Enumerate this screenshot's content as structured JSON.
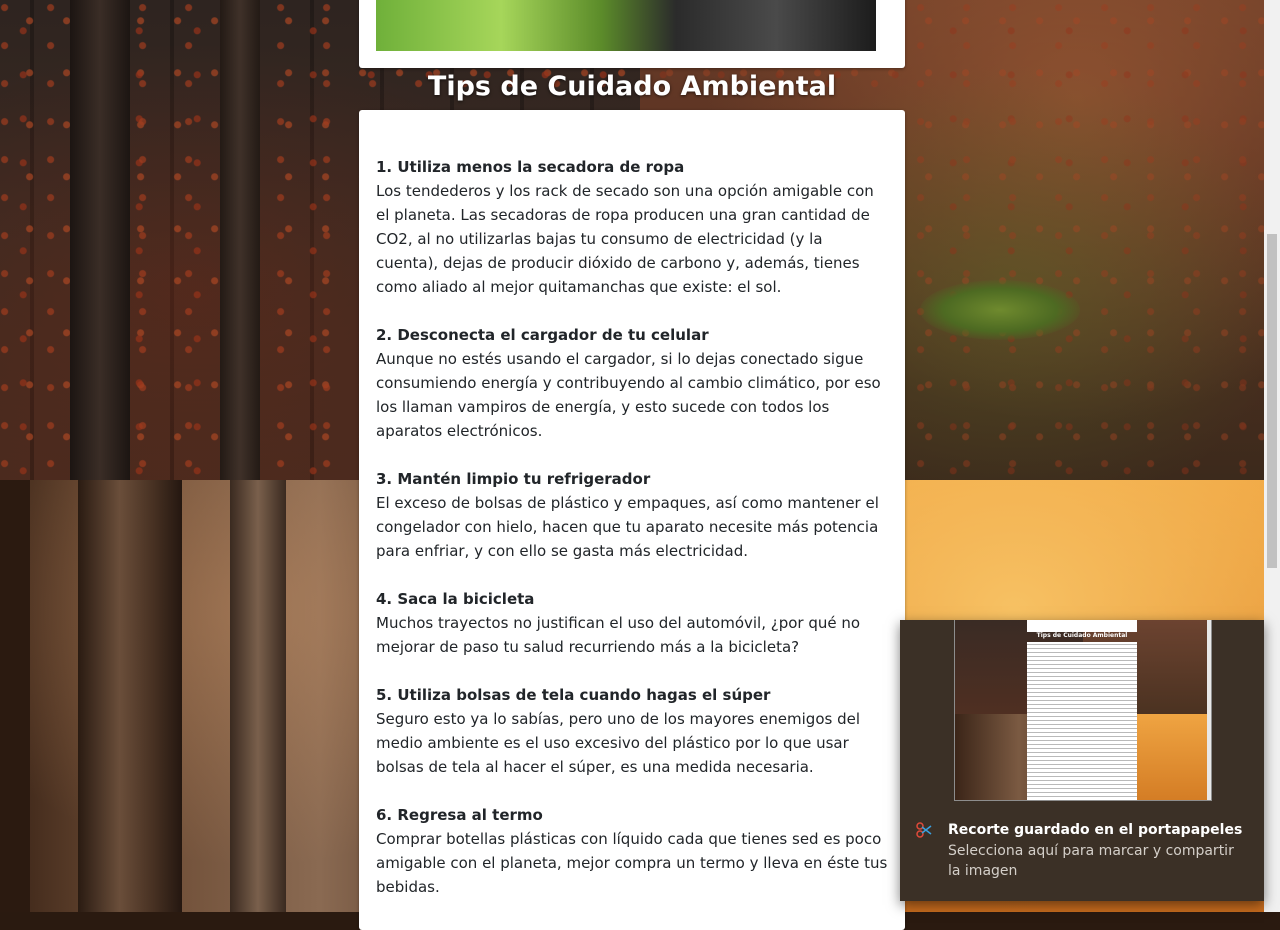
{
  "section_title": "Tips de Cuidado Ambiental",
  "tips": [
    {
      "title": "1. Utiliza menos la secadora de ropa",
      "text": "Los tendederos y los rack de secado son una opción amigable con el planeta. Las secadoras de ropa producen una gran cantidad de CO2, al no utilizarlas bajas tu consumo de electricidad (y la cuenta), dejas de producir dióxido de carbono y, además, tienes como aliado al mejor quitamanchas que existe: el sol."
    },
    {
      "title": "2. Desconecta el cargador de tu celular",
      "text": "Aunque no estés usando el cargador, si lo dejas conectado sigue consumiendo energía y contribuyendo al cambio climático, por eso los llaman vampiros de energía, y esto sucede con todos los aparatos electrónicos."
    },
    {
      "title": "3. Mantén limpio tu refrigerador",
      "text": "El exceso de bolsas de plástico y empaques, así como mantener el congelador con hielo, hacen que tu aparato necesite más potencia para enfriar, y con ello se gasta más electricidad."
    },
    {
      "title": "4. Saca la bicicleta",
      "text": "Muchos trayectos no justifican el uso del automóvil, ¿por qué no mejorar de paso tu salud recurriendo más a la bicicleta?"
    },
    {
      "title": "5. Utiliza bolsas de tela cuando hagas el súper",
      "text": "Seguro esto ya lo sabías, pero uno de los mayores enemigos del medio ambiente es el uso excesivo del plástico por lo que usar bolsas de tela al hacer el súper, es una medida necesaria."
    },
    {
      "title": "6. Regresa al termo",
      "text": "Comprar botellas plásticas con líquido cada que tienes sed es poco amigable con el planeta, mejor compra un termo y lleva en éste tus bebidas."
    }
  ],
  "notification": {
    "icon": "snip-sketch-icon",
    "title": "Recorte guardado en el portapapeles",
    "body": "Selecciona aquí para marcar y compartir la imagen",
    "preview_title": "Tips de Cuidado Ambiental"
  },
  "colors": {
    "card": "#ffffff",
    "text": "#212529",
    "toast_bg": "#3b3026"
  }
}
